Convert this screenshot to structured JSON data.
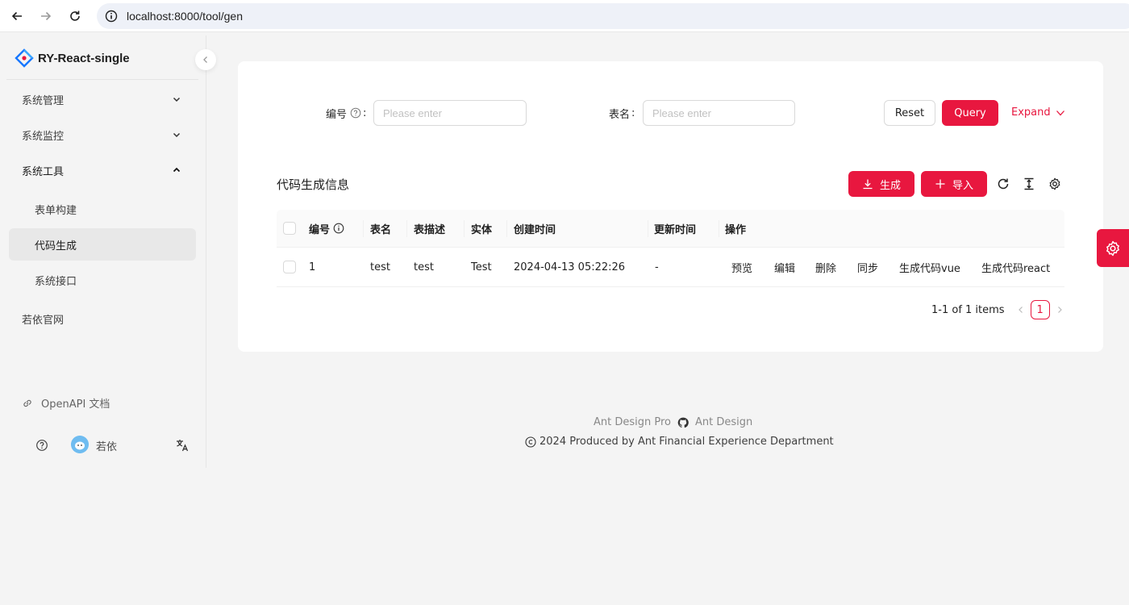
{
  "browser": {
    "url": "localhost:8000/tool/gen"
  },
  "app": {
    "title": "RY-React-single"
  },
  "sidebar": {
    "items": [
      {
        "label": "系统管理"
      },
      {
        "label": "系统监控"
      },
      {
        "label": "系统工具"
      },
      {
        "label": "表单构建"
      },
      {
        "label": "代码生成"
      },
      {
        "label": "系统接口"
      },
      {
        "label": "若依官网"
      }
    ],
    "openapi": "OpenAPI 文档",
    "user": "若依"
  },
  "search": {
    "field1_label": "编号",
    "field1_placeholder": "Please enter",
    "field2_label": "表名",
    "field2_placeholder": "Please enter",
    "reset": "Reset",
    "query": "Query",
    "expand": "Expand"
  },
  "toolbar": {
    "title": "代码生成信息",
    "generate": "生成",
    "import": "导入"
  },
  "table": {
    "columns": [
      "编号",
      "表名",
      "表描述",
      "实体",
      "创建时间",
      "更新时间",
      "操作"
    ],
    "rows": [
      {
        "id": "1",
        "table_name": "test",
        "description": "test",
        "entity": "Test",
        "created": "2024-04-13 05:22:26",
        "updated": "-",
        "actions": [
          "预览",
          "编辑",
          "删除",
          "同步",
          "生成代码vue",
          "生成代码react"
        ]
      }
    ]
  },
  "pagination": {
    "summary": "1-1 of 1 items",
    "current": "1"
  },
  "footer": {
    "link1": "Ant Design Pro",
    "link2": "Ant Design",
    "copyright": "2024 Produced by Ant Financial Experience Department"
  },
  "colors": {
    "primary": "#e8173f",
    "link": "#1677ff",
    "danger": "#ff4d4f"
  }
}
